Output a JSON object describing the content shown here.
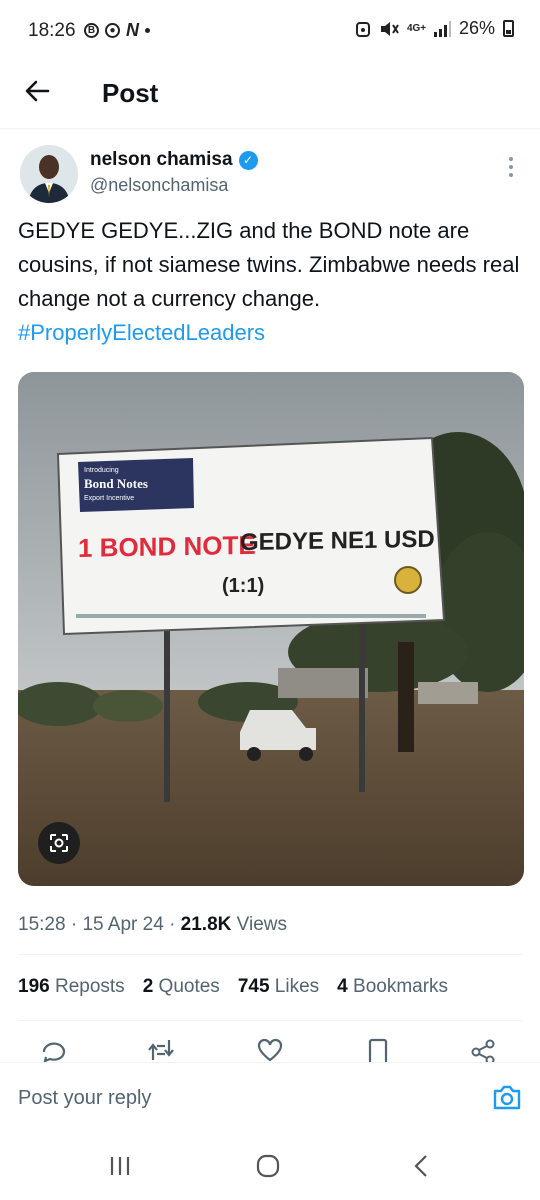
{
  "status_bar": {
    "time": "18:26",
    "network": "4G+",
    "battery": "26%"
  },
  "header": {
    "title": "Post"
  },
  "author": {
    "name": "nelson chamisa",
    "handle": "@nelsonchamisa"
  },
  "tweet": {
    "text": "GEDYE GEDYE...ZIG and the BOND note are cousins, if not siamese twins. Zimbabwe needs real change not a currency change.",
    "hashtag": "#ProperlyElectedLeaders"
  },
  "billboard": {
    "kicker": "Introducing",
    "badge": "Bond Notes",
    "badge_sub": "Export Incentive",
    "headline_red": "1 BOND NOTE",
    "headline_black": "GEDYE NE1 USD",
    "ratio": "(1:1)"
  },
  "meta": {
    "time": "15:28",
    "date": "15 Apr 24",
    "views_count": "21.8K",
    "views_label": "Views"
  },
  "stats": {
    "reposts_count": "196",
    "reposts_label": "Reposts",
    "quotes_count": "2",
    "quotes_label": "Quotes",
    "likes_count": "745",
    "likes_label": "Likes",
    "bookmarks_count": "4",
    "bookmarks_label": "Bookmarks"
  },
  "reply": {
    "placeholder": "Post your reply"
  },
  "colors": {
    "accent": "#1d9bf0",
    "text": "#0f1419",
    "secondary": "#536471",
    "billboard_red": "#e02b3c"
  }
}
